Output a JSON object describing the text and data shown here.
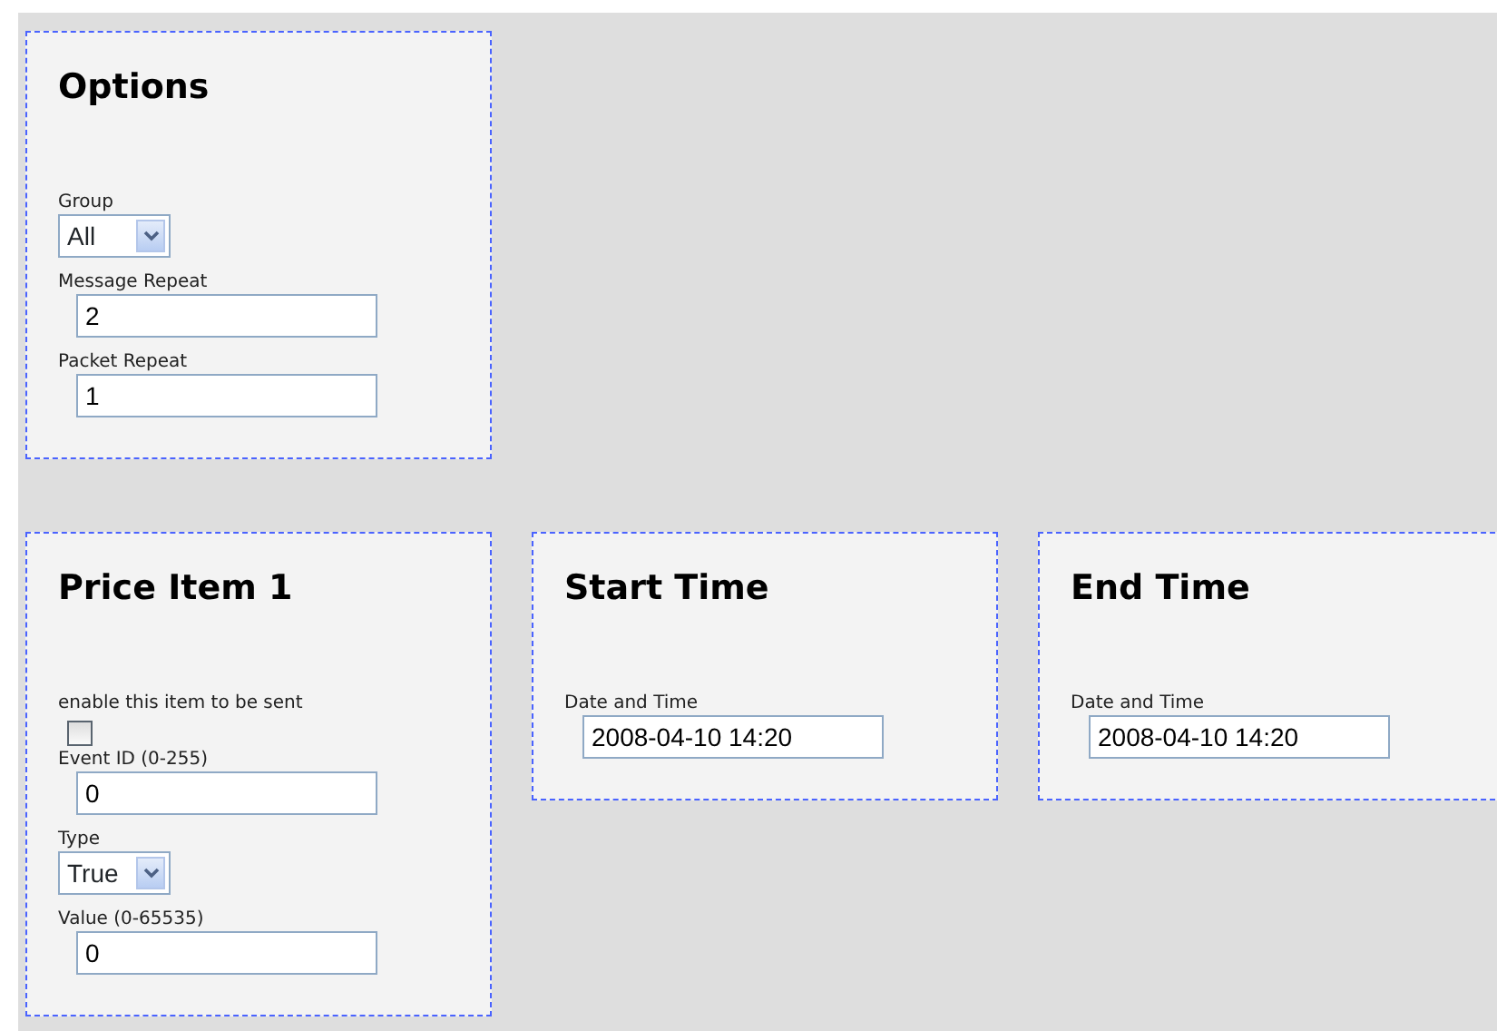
{
  "rows": [
    {
      "panels": [
        {
          "title": "Options",
          "fields": [
            {
              "kind": "select",
              "label": "Group",
              "value": "All"
            },
            {
              "kind": "text",
              "label": "Message Repeat",
              "value": "2"
            },
            {
              "kind": "text",
              "label": "Packet Repeat",
              "value": "1"
            }
          ]
        }
      ]
    },
    {
      "panels": [
        {
          "title": "Price Item 1",
          "fields": [
            {
              "kind": "checkbox",
              "label": "enable this item to be sent",
              "checked": false
            },
            {
              "kind": "text",
              "label": "Event ID (0-255)",
              "value": "0"
            },
            {
              "kind": "select",
              "label": "Type",
              "value": "True"
            },
            {
              "kind": "text",
              "label": "Value (0-65535)",
              "value": "0"
            }
          ]
        },
        {
          "title": "Start Time",
          "fields": [
            {
              "kind": "text",
              "label": "Date and Time",
              "value": "2008-04-10 14:20"
            }
          ]
        },
        {
          "title": "End Time",
          "fields": [
            {
              "kind": "text",
              "label": "Date and Time",
              "value": "2008-04-10 14:20"
            }
          ]
        }
      ]
    }
  ]
}
